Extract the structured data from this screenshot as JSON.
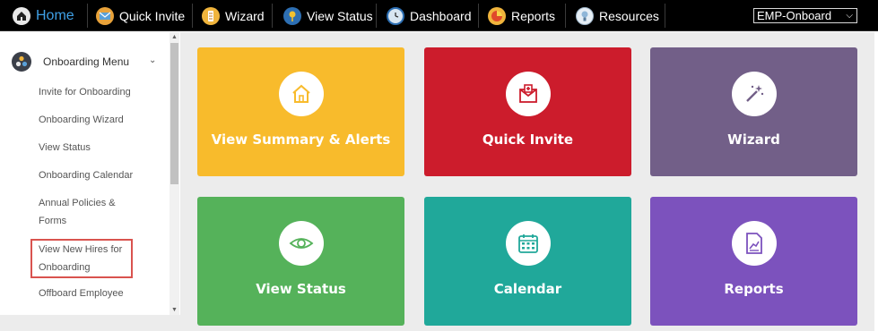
{
  "nav": {
    "items": [
      {
        "label": "Home",
        "icon": "home-icon"
      },
      {
        "label": "Quick Invite",
        "icon": "envelope-icon"
      },
      {
        "label": "Wizard",
        "icon": "wizard-icon"
      },
      {
        "label": "View Status",
        "icon": "pin-icon"
      },
      {
        "label": "Dashboard",
        "icon": "clock-icon"
      },
      {
        "label": "Reports",
        "icon": "pie-chart-icon"
      },
      {
        "label": "Resources",
        "icon": "lightbulb-icon"
      }
    ],
    "env_select": {
      "value": "EMP-Onboard"
    }
  },
  "sidebar": {
    "menu_title": "Onboarding Menu",
    "links": [
      {
        "label": "Invite for Onboarding"
      },
      {
        "label": "Onboarding Wizard"
      },
      {
        "label": "View Status"
      },
      {
        "label": "Onboarding Calendar"
      },
      {
        "label": "Annual Policies & Forms"
      },
      {
        "label": "View New Hires for Onboarding"
      },
      {
        "label": "Offboard Employee"
      }
    ]
  },
  "tiles": [
    {
      "label": "View Summary & Alerts",
      "color": "#f8bb2c",
      "icon": "home-icon",
      "icon_color": "#f8bb2c"
    },
    {
      "label": "Quick Invite",
      "color": "#cc1c2c",
      "icon": "envelope-icon",
      "icon_color": "#cc1c2c"
    },
    {
      "label": "Wizard",
      "color": "#725f88",
      "icon": "magic-wand-icon",
      "icon_color": "#725f88"
    },
    {
      "label": "View Status",
      "color": "#55b25a",
      "icon": "eye-icon",
      "icon_color": "#55b25a"
    },
    {
      "label": "Calendar",
      "color": "#20a89a",
      "icon": "calendar-icon",
      "icon_color": "#20a89a"
    },
    {
      "label": "Reports",
      "color": "#7c52bd",
      "icon": "report-icon",
      "icon_color": "#7c52bd"
    }
  ]
}
